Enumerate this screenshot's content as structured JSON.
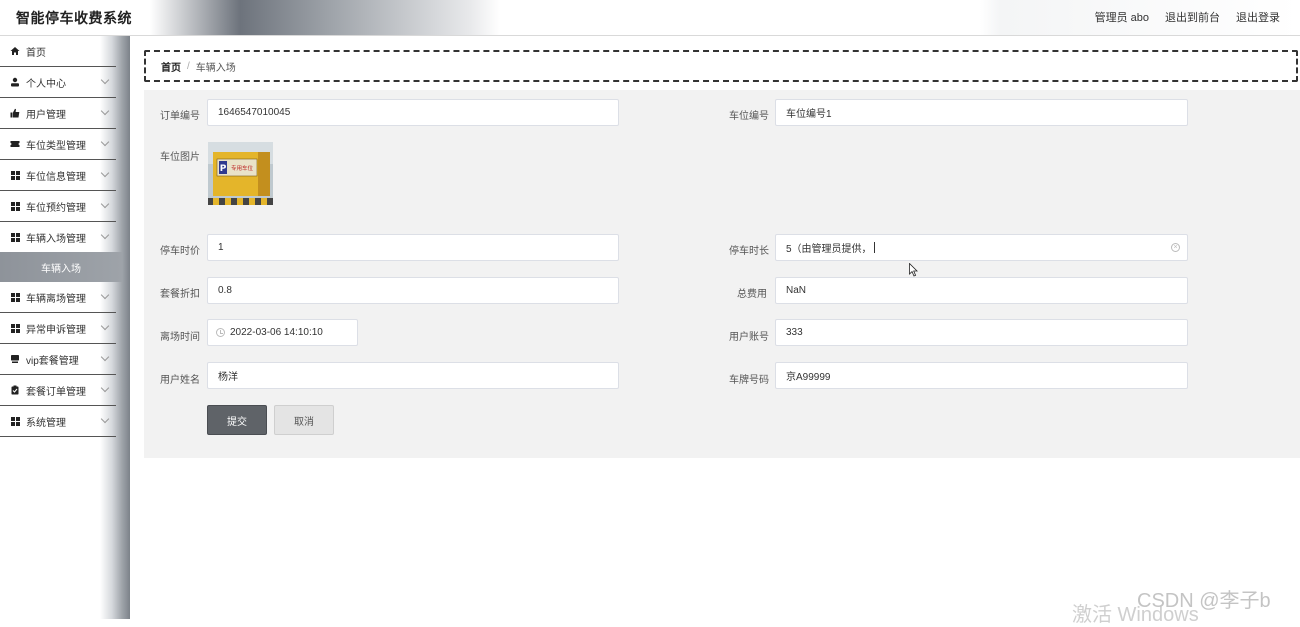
{
  "header": {
    "title": "智能停车收费系统",
    "admin_label": "管理员 abo",
    "back_front_label": "退出到前台",
    "logout_label": "退出登录"
  },
  "sidebar": {
    "items": [
      {
        "label": "首页",
        "icon": "home-icon"
      },
      {
        "label": "个人中心",
        "icon": "user-icon"
      },
      {
        "label": "用户管理",
        "icon": "thumbs-up-icon"
      },
      {
        "label": "车位类型管理",
        "icon": "ticket-icon"
      },
      {
        "label": "车位信息管理",
        "icon": "grid-icon"
      },
      {
        "label": "车位预约管理",
        "icon": "grid-icon"
      },
      {
        "label": "车辆入场管理",
        "icon": "grid-icon"
      },
      {
        "label": "车辆离场管理",
        "icon": "grid-icon"
      },
      {
        "label": "异常申诉管理",
        "icon": "grid-icon"
      },
      {
        "label": "vip套餐管理",
        "icon": "monitor-icon"
      },
      {
        "label": "套餐订单管理",
        "icon": "clipboard-icon"
      },
      {
        "label": "系统管理",
        "icon": "grid-icon"
      }
    ],
    "active_sub": "车辆入场"
  },
  "breadcrumb": {
    "home": "首页",
    "separator": "/",
    "current": "车辆入场"
  },
  "form": {
    "order_no_label": "订单编号",
    "order_no_value": "1646547010045",
    "space_no_label": "车位编号",
    "space_no_value": "车位编号1",
    "space_img_label": "车位图片",
    "space_img_sign": "专用车位",
    "hourly_price_label": "停车时价",
    "hourly_price_value": "1",
    "duration_label": "停车时长",
    "duration_value": "5（由管理员提供，",
    "discount_label": "套餐折扣",
    "discount_value": "0.8",
    "total_label": "总费用",
    "total_value": "NaN",
    "leave_time_label": "离场时间",
    "leave_time_value": "2022-03-06 14:10:10",
    "account_label": "用户账号",
    "account_value": "333",
    "name_label": "用户姓名",
    "name_value": "杨洋",
    "plate_label": "车牌号码",
    "plate_value": "京A99999",
    "submit_label": "提交",
    "cancel_label": "取消"
  },
  "watermark": {
    "windows": "激活 Windows",
    "csdn": "CSDN @李子b"
  }
}
